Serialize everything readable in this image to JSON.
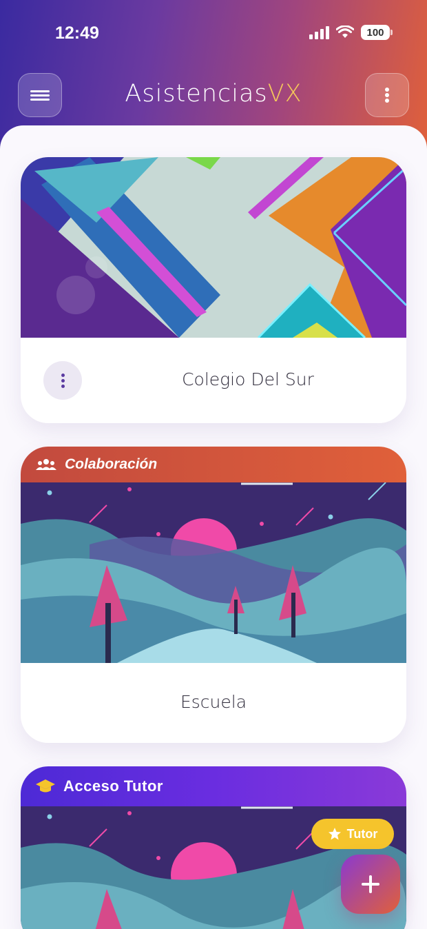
{
  "status_bar": {
    "time": "12:49",
    "battery": "100"
  },
  "header": {
    "title_main": "Asistencias",
    "title_accent": "VX",
    "accent_color": "#f5c85a",
    "menu_icon": "hamburger-icon",
    "more_icon": "kebab-icon"
  },
  "cards": [
    {
      "title": "Colegio Del Sur",
      "menu_icon": "kebab-icon"
    },
    {
      "banner_label": "Colaboración",
      "banner_icon": "group-icon",
      "title": "Escuela"
    },
    {
      "banner_label": "Acceso Tutor",
      "banner_icon": "graduation-cap-icon",
      "badge_label": "Tutor",
      "badge_icon": "star-icon"
    }
  ],
  "fab": {
    "icon": "plus-icon"
  }
}
